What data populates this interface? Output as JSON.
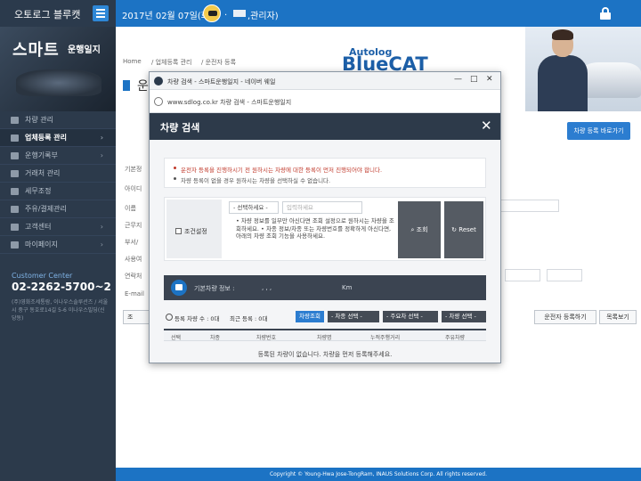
{
  "topbar": {
    "brand": "오토로그 블루캣",
    "date": "2017년 02월 07일(화)",
    "user_sep": ".",
    "user_role": ",관리자)"
  },
  "sidebar": {
    "logo_main": "스마트",
    "logo_sub": "운행일지",
    "items": [
      {
        "label": "차량 관리",
        "chev": ""
      },
      {
        "label": "업체등록 관리",
        "chev": "›"
      },
      {
        "label": "운행기록부",
        "chev": "›"
      },
      {
        "label": "거래처 관리",
        "chev": ""
      },
      {
        "label": "세무조정",
        "chev": ""
      },
      {
        "label": "주유/결제관리",
        "chev": ""
      },
      {
        "label": "고객센터",
        "chev": "›"
      },
      {
        "label": "마이페이지",
        "chev": "›"
      }
    ],
    "cs_label": "Customer Center",
    "cs_phone": "02-2262-5700~2",
    "cs_addr": "(주)영화조세통람, 이나우스솔루션즈 / 서울시 중구 동호로14길 5-6 이나우스빌딩(신당동)"
  },
  "main": {
    "breadcrumb": [
      "Home",
      "/ 업체등록 관리",
      "/ 운전자 등록"
    ],
    "page_title": "운",
    "logo_autolog": "Autolog",
    "logo_bluecat": "BlueCAT",
    "right_btn": "차량 등록 바로가기",
    "rows": [
      {
        "label": "기본정"
      },
      {
        "label": "아이디"
      },
      {
        "label": "이름"
      },
      {
        "label": "근무지"
      },
      {
        "label": "부서/"
      },
      {
        "label": "사용여"
      },
      {
        "label": "연락처"
      },
      {
        "label": "E-mail"
      }
    ],
    "bottom_left_btn": "조",
    "btn_reg_driver": "운전자 등록하기",
    "btn_list": "목록보기"
  },
  "footer": {
    "text": "Copyright © Young-Hwa Jose-TongRam, INAUS Solutions Corp. All rights reserved."
  },
  "popup": {
    "win_title": "차량 검색 - 스마트운행일지 - 네이버 웨일",
    "win_min": "—",
    "win_max": "□",
    "win_close": "✕",
    "address": "www.sdlog.co.kr 차량 검색 - 스마트운행일지",
    "modal_title": "차량 검색",
    "modal_close": "✕",
    "notice_1": "운전자 등록을 진행하시기 전 원하시는 차량에 대한 등록이 먼저 진행되어야 합니다.",
    "notice_2": "차량 등록이 없을 경우 원하시는 차량을 선택하실 수 없습니다.",
    "cond_label": "조건설정",
    "cond_select": "- 선택하세요 -",
    "cond_input_placeholder": "입력하세요",
    "cond_help": "• 차량 정보를 일부만 아신다면 조회 설정으로 원하시는 차량을 조회하세요. • 차종 정보/차종 또는 차량번호를 정확하게 아신다면, 아래의 차량 조회 기능을 사용하세요.",
    "btn_search": "조회",
    "btn_reset": "Reset",
    "basic_label": "기본차량 정보 :",
    "basic_dots": ",          ,          ,",
    "basic_km": "Km",
    "reg_count": "등록 차량 수 : 0대",
    "reg_recent": "최근 등록 : 0대",
    "btn_car_search": "차량조회",
    "sel_1": "- 차종 선택 -",
    "sel_2": "- 주요차 선택 -",
    "sel_3": "- 차량 선택 -",
    "table_headers": [
      "선택",
      "차종",
      "차량번호",
      "차량명",
      "누적주행거리",
      "주유차량"
    ],
    "empty_msg": "등록된 차량이 없습니다. 차량을 먼저 등록해주세요."
  }
}
